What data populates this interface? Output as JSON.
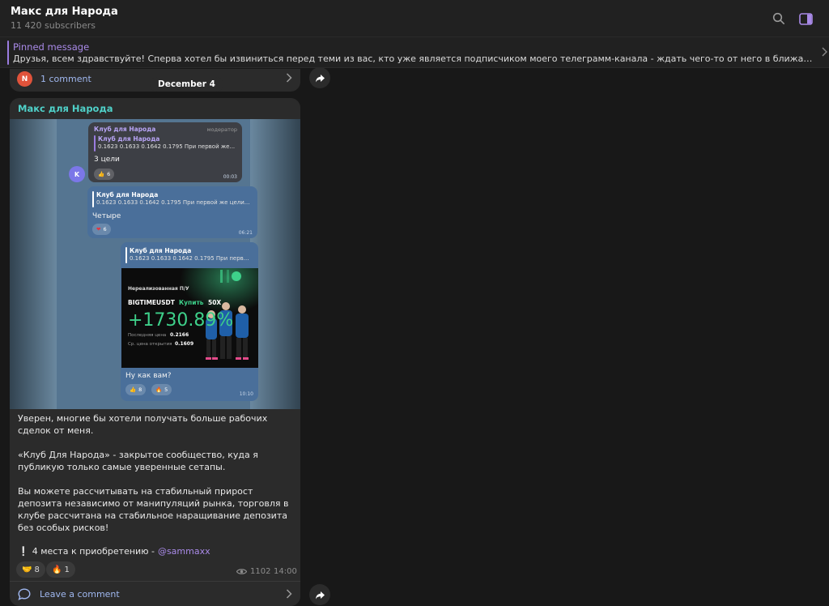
{
  "header": {
    "channel_name": "Макс для Народа",
    "subscribers": "11 420 subscribers",
    "icons": [
      "search-icon",
      "sidebar-toggle-icon"
    ]
  },
  "pinned": {
    "title": "Pinned message",
    "text": "Друзья, всем здравствуйте!  Сперва хотел бы извиниться перед теми из вас, кто уже является подписчиком моего телеграмм-канала - ждать чего-то от него в ближайшем будущем не ну..."
  },
  "previous_post": {
    "avatar_letter": "N",
    "comments_label": "1 comment"
  },
  "date_separator": "December 4",
  "post": {
    "author": "Макс для Народа",
    "media": {
      "msg1": {
        "name": "Клуб для Народа",
        "role": "модератор",
        "quote_name": "Клуб для Народа",
        "quote_text": "0.1623 0.1633 0.1642 0.1795 При первой же...",
        "text": "3 цели",
        "reaction_count": "6",
        "time": "00:03",
        "avatar_letter": "K"
      },
      "msg2": {
        "quote_name": "Клуб для Народа",
        "quote_text": "0.1623 0.1633 0.1642 0.1795 При первой же цели...",
        "text": "Четыре",
        "reaction_count": "6",
        "time": "06:21"
      },
      "msg3": {
        "quote_name": "Клуб для Народа",
        "quote_text": "0.1623 0.1633 0.1642 0.1795 При перв...",
        "trade": {
          "label": "Нереализованная П/У",
          "pair": "BIGTIMEUSDT",
          "action": "Купить",
          "leverage": "50X",
          "pnl": "+1730.89%",
          "last_price_label": "Последняя цена",
          "last_price": "0.2166",
          "entry_price_label": "Ср. цена открытия",
          "entry_price": "0.1609"
        },
        "text": "Ну как вам?",
        "reaction1_count": "8",
        "reaction2_count": "5",
        "time": "10:10"
      }
    },
    "paragraphs": [
      "Уверен, многие бы хотели получать больше рабочих сделок от меня.",
      "«Клуб Для Народа» - закрытое сообщество, куда я публикую только самые уверенные сетапы.",
      "Вы можете рассчитывать на стабильный прирост депозита независимо от манипуляций рынка, торговля в клубе рассчитана на стабильное наращивание депозита без особых рисков!"
    ],
    "slots_text": "4 места к приобретению -",
    "mention": "@sammaxx",
    "reactions": [
      {
        "emoji": "🤝",
        "count": "8"
      },
      {
        "emoji": "🔥",
        "count": "1"
      }
    ],
    "views": "1102",
    "time": "14:00",
    "leave_comment": "Leave a comment"
  },
  "colors": {
    "accent": "#a98ae8",
    "author": "#4fd0c8",
    "link": "#a0b8f0",
    "profit": "#3ed08a"
  }
}
